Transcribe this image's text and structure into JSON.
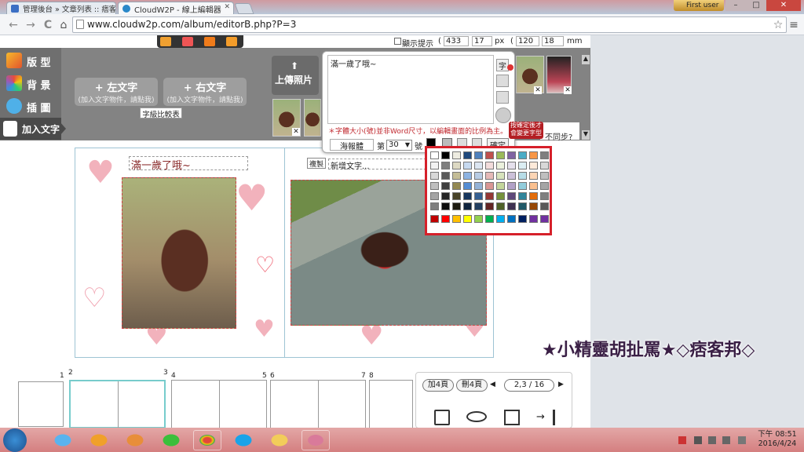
{
  "browser": {
    "tabs": [
      {
        "label": "管理後台 » 文章列表 :: 痞客邦"
      },
      {
        "label": "CloudW2P - 線上編輯器"
      }
    ],
    "user_button": "First user",
    "window_controls": {
      "minimize": "–",
      "maximize": "□",
      "close": "✕"
    },
    "url": "www.cloudw2p.com/album/editorB.php?P=3",
    "nav": {
      "back": "←",
      "forward": "→",
      "reload": "C",
      "star": "☆",
      "menu": "≡"
    }
  },
  "editor": {
    "ruler": {
      "show_hint_label": "顯示提示",
      "x_val": "433",
      "y_val": "17",
      "px_unit": "px",
      "w_val": "120",
      "h_val": "18",
      "mm_unit": "mm"
    },
    "sidebar": [
      {
        "label": "版 型"
      },
      {
        "label": "背 景"
      },
      {
        "label": "插 圖"
      },
      {
        "label": "加入文字"
      }
    ],
    "left_text_btn": {
      "title": "+ 左文字",
      "sub": "(加入文字物件，請點我)"
    },
    "right_text_btn": {
      "title": "+ 右文字",
      "sub": "(加入文字物件，請點我)"
    },
    "font_compare": "字級比較表",
    "upload_photo": "上傳照片",
    "not_same_hint": "不同步?",
    "text_popup": {
      "textarea_value": "滿一歲了哦~",
      "hint": "＊字體大小(號)並非Word尺寸，以編輯畫面的比例為主。",
      "font_name": "海報體",
      "size_prefix": "第",
      "size_value": "30",
      "size_suffix": "號",
      "confirm_button": "確定",
      "tooltip": "按確定後才會變更字型"
    },
    "album": {
      "left_title": "滿一歲了哦~",
      "copy_button": "複製",
      "new_text": "新增文字..."
    },
    "pages": {
      "numbers": [
        "1",
        "2",
        "3",
        "4",
        "5",
        "6",
        "7",
        "8"
      ],
      "add_pages": "加4頁",
      "del_pages": "刪4頁",
      "prev": "◀",
      "next": "▶",
      "page_indicator": "2,3 / 16"
    }
  },
  "palette": {
    "rows": [
      [
        "#ffffff",
        "#000000",
        "#eeece1",
        "#1f497d",
        "#4f81bd",
        "#c0504d",
        "#9bbb59",
        "#8064a2",
        "#4bacc6",
        "#f79646",
        "#7f7f7f"
      ],
      [
        "#f2f2f2",
        "#7f7f7f",
        "#ddd9c3",
        "#c6d9f0",
        "#dbe5f1",
        "#f2dcdb",
        "#ebf1dd",
        "#e5e0ec",
        "#dbeef3",
        "#fdeada",
        "#d8d8d8"
      ],
      [
        "#d8d8d8",
        "#595959",
        "#c4bd97",
        "#8db3e2",
        "#b8cce4",
        "#e5b9b7",
        "#d7e3bc",
        "#ccc1d9",
        "#b7dde8",
        "#fbd5b5",
        "#bfbfbf"
      ],
      [
        "#bfbfbf",
        "#3f3f3f",
        "#938953",
        "#548dd4",
        "#95b3d7",
        "#d99694",
        "#c3d69b",
        "#b2a2c7",
        "#92cddc",
        "#fac08f",
        "#a5a5a5"
      ],
      [
        "#a5a5a5",
        "#262626",
        "#494429",
        "#17365d",
        "#366092",
        "#953734",
        "#76923c",
        "#5f497a",
        "#31859b",
        "#e36c09",
        "#7f7f7f"
      ],
      [
        "#7f7f7f",
        "#0c0c0c",
        "#1d1b10",
        "#0f243e",
        "#244061",
        "#632423",
        "#4f6128",
        "#3f3151",
        "#205867",
        "#974806",
        "#595959"
      ],
      [
        "#c00000",
        "#ff0000",
        "#ffc000",
        "#ffff00",
        "#92d050",
        "#00b050",
        "#00b0f0",
        "#0070c0",
        "#002060",
        "#7030a0",
        "#7030a0"
      ]
    ]
  },
  "watermark": "★小精靈胡扯罵★◇痞客邦◇",
  "taskbar": {
    "clock_time": "下午 08:51",
    "clock_date": "2016/4/24"
  }
}
